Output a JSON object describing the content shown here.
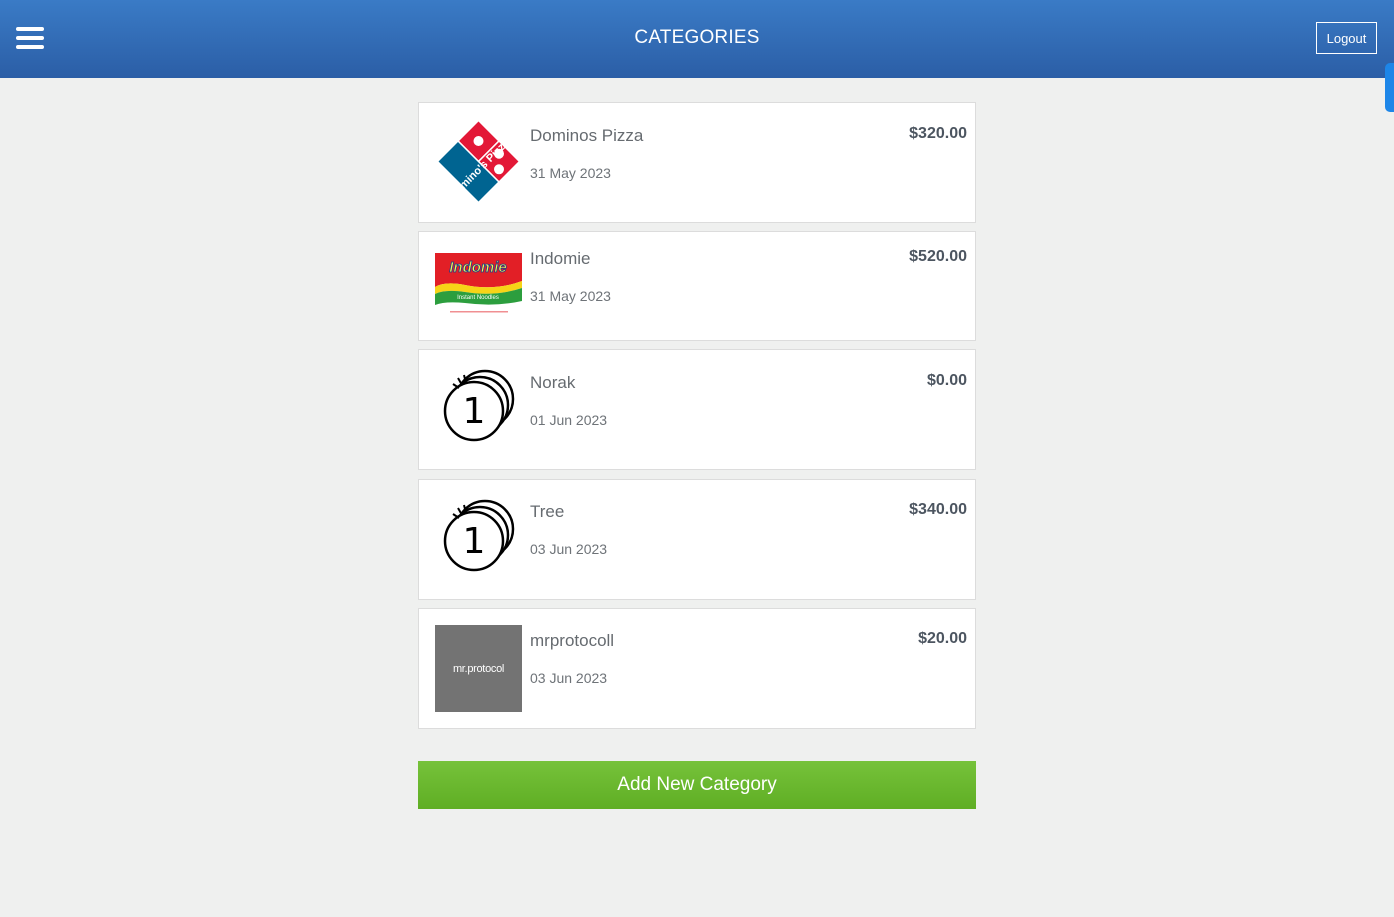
{
  "header": {
    "title": "CATEGORIES",
    "logout_label": "Logout",
    "menu_icon": "hamburger-menu-icon"
  },
  "categories": [
    {
      "name": "Dominos Pizza",
      "date": "31 May 2023",
      "amount": "$320.00",
      "icon": "dominos-pizza-logo",
      "logo_text": "Domino's Pizza"
    },
    {
      "name": "Indomie",
      "date": "31 May 2023",
      "amount": "$520.00",
      "icon": "indomie-logo",
      "logo_text": "Indomie",
      "logo_subtext": "Instant Noodles"
    },
    {
      "name": "Norak",
      "date": "01 Jun 2023",
      "amount": "$0.00",
      "icon": "coin-stack-icon",
      "logo_text": "1"
    },
    {
      "name": "Tree",
      "date": "03 Jun 2023",
      "amount": "$340.00",
      "icon": "coin-stack-icon",
      "logo_text": "1"
    },
    {
      "name": "mrprotocoll",
      "date": "03 Jun 2023",
      "amount": "$20.00",
      "icon": "mrprotocol-logo",
      "logo_text": "mr.protocol"
    }
  ],
  "add_button_label": "Add New Category",
  "colors": {
    "header_top": "#3a7bc6",
    "header_bottom": "#2b5ea6",
    "add_button": "#6aba2f",
    "background": "#eff0ef",
    "scroll_thumb": "#1d86e8"
  }
}
